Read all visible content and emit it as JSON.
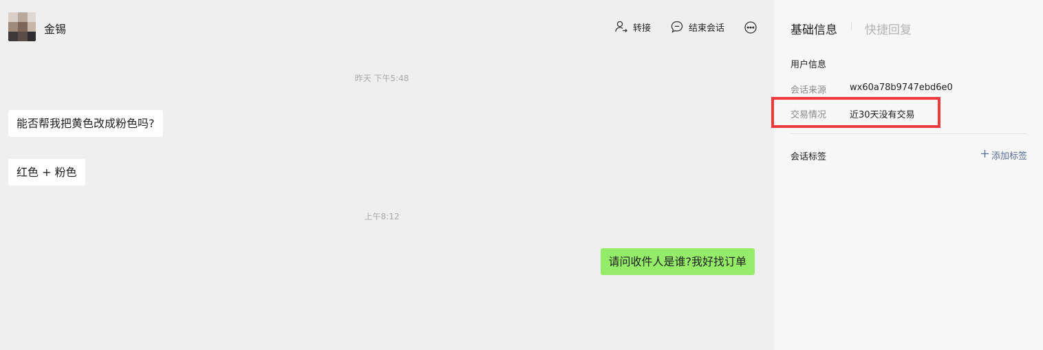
{
  "contact": {
    "name": "金锡"
  },
  "header_actions": {
    "transfer_label": "转接",
    "end_session_label": "结束会话"
  },
  "messages": [
    {
      "type": "timestamp",
      "text": "昨天 下午5:48"
    },
    {
      "type": "incoming",
      "text": "能否帮我把黄色改成粉色吗?"
    },
    {
      "type": "incoming",
      "text": "红色 + 粉色"
    },
    {
      "type": "timestamp",
      "text": "上午8:12"
    },
    {
      "type": "outgoing",
      "text": "请问收件人是谁?我好找订单"
    }
  ],
  "side_panel": {
    "tabs": [
      {
        "label": "基础信息",
        "active": true
      },
      {
        "label": "快捷回复",
        "active": false
      }
    ],
    "user_info": {
      "title": "用户信息",
      "rows": [
        {
          "label": "会话来源",
          "value": "wx60a78b9747ebd6e0"
        },
        {
          "label": "交易情况",
          "value": "近30天没有交易"
        }
      ]
    },
    "tags": {
      "title": "会话标签",
      "add_label": "添加标签"
    }
  },
  "colors": {
    "outgoing_bubble": "#95ec69",
    "incoming_bubble": "#ffffff",
    "highlight_box": "#f03a3a",
    "link": "#576b95"
  }
}
